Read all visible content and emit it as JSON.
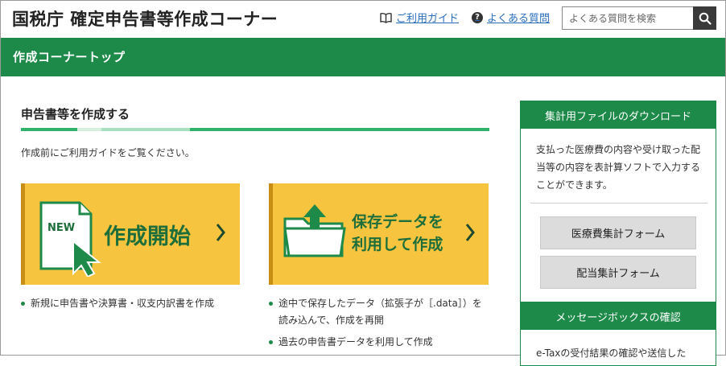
{
  "header": {
    "title": "国税庁 確定申告書等作成コーナー",
    "guide_link": "ご利用ガイド",
    "faq_link": "よくある質問",
    "search_placeholder": "よくある質問を検索"
  },
  "nav": {
    "breadcrumb": "作成コーナートップ"
  },
  "main": {
    "section_title": "申告書等を作成する",
    "intro": "作成前にご利用ガイドをご覧ください。",
    "cards": [
      {
        "badge": "NEW",
        "label": "作成開始",
        "bullets": [
          "新規に申告書や決算書・収支内訳書を作成"
        ]
      },
      {
        "label": "保存データを利用して作成",
        "bullets": [
          "途中で保存したデータ（拡張子が［.data］）を読み込んで、作成を再開",
          "過去の申告書データを利用して作成"
        ]
      }
    ]
  },
  "sidebar": {
    "download": {
      "title": "集計用ファイルのダウンロード",
      "text": "支払った医療費の内容や受け取った配当等の内容を表計算ソフトで入力することができます。",
      "buttons": [
        "医療費集計フォーム",
        "配当集計フォーム"
      ]
    },
    "messagebox": {
      "title": "メッセージボックスの確認",
      "text": "e-Taxの受付結果の確認や送信した"
    }
  },
  "colors": {
    "green": "#1d8a4a",
    "card_yellow": "#f7c440",
    "link_blue": "#2a6ebb"
  }
}
